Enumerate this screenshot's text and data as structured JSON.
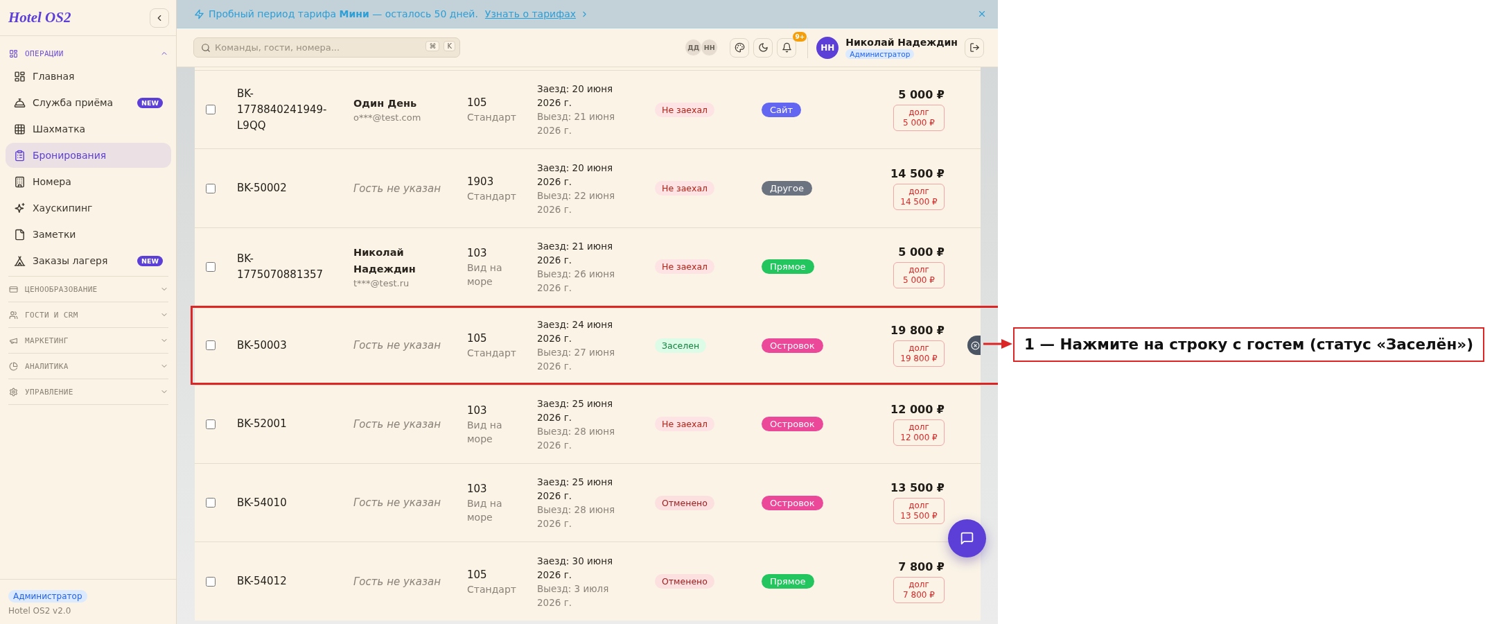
{
  "banner": {
    "message": "Пробный период тарифа **Мини** — осталось 50 дней.",
    "link": "Узнать о тарифах"
  },
  "sidebar": {
    "logo": "Hotel OS2",
    "sections": [
      {
        "label": "ОПЕРАЦИИ",
        "expanded": true,
        "items": [
          {
            "label": "Главная",
            "selected": false
          },
          {
            "label": "Служба приёма",
            "selected": false,
            "badge": "NEW"
          },
          {
            "label": "Шахматка",
            "selected": false
          },
          {
            "label": "Бронирования",
            "selected": true
          },
          {
            "label": "Номера",
            "selected": false
          },
          {
            "label": "Хаускипинг",
            "selected": false
          },
          {
            "label": "Заметки",
            "selected": false
          },
          {
            "label": "Заказы лагеря",
            "selected": false,
            "badge": "NEW"
          }
        ]
      },
      {
        "label": "ЦЕНООБРАЗОВАНИЕ",
        "expanded": false
      },
      {
        "label": "ГОСТИ И CRM",
        "expanded": false
      },
      {
        "label": "МАРКЕТИНГ",
        "expanded": false
      },
      {
        "label": "АНАЛИТИКА",
        "expanded": false
      },
      {
        "label": "УПРАВЛЕНИЕ",
        "expanded": false
      }
    ],
    "footer": {
      "role": "Администратор",
      "version": "Hotel OS2 v2.0"
    }
  },
  "topbar": {
    "search": {
      "placeholder": "Команды, гости, номера...",
      "shortcut": [
        "⌘",
        "K"
      ]
    },
    "online_users": [
      "ДД",
      "НН"
    ],
    "notifications_badge": "9+",
    "user": {
      "initials": "НН",
      "name": "Николай Надеждин",
      "role": "Администратор"
    }
  },
  "table": {
    "rows": [
      {
        "selected": false,
        "id": "BK-1778840241949-L9QQ",
        "guest": {
          "kind": "known",
          "name": "Один День",
          "email": "o***@test.com"
        },
        "room": {
          "number": "105",
          "type": "Стандарт"
        },
        "check_in": "Заезд: 20 июня 2026 г.",
        "check_out": "Выезд: 21 июня 2026 г.",
        "status": {
          "label": "Не заехал",
          "kind": "not_arrived"
        },
        "source": {
          "label": "Сайт",
          "color": "#6366f1"
        },
        "total": "5 000 ₽",
        "debt": {
          "label": "долг",
          "amount": "5 000 ₽"
        },
        "highlighted": false,
        "hovered": false
      },
      {
        "selected": false,
        "id": "BK-50002",
        "guest": {
          "kind": "unknown",
          "name": "Гость не указан"
        },
        "room": {
          "number": "1903",
          "type": "Стандарт"
        },
        "check_in": "Заезд: 20 июня 2026 г.",
        "check_out": "Выезд: 22 июня 2026 г.",
        "status": {
          "label": "Не заехал",
          "kind": "not_arrived"
        },
        "source": {
          "label": "Другое",
          "color": "#6b7280"
        },
        "total": "14 500 ₽",
        "debt": {
          "label": "долг",
          "amount": "14 500 ₽"
        },
        "highlighted": false,
        "hovered": false
      },
      {
        "selected": false,
        "id": "BK-1775070881357",
        "guest": {
          "kind": "known",
          "name": "Николай Надеждин",
          "email": "t***@test.ru"
        },
        "room": {
          "number": "103",
          "type": "Вид на море"
        },
        "check_in": "Заезд: 21 июня 2026 г.",
        "check_out": "Выезд: 26 июня 2026 г.",
        "status": {
          "label": "Не заехал",
          "kind": "not_arrived"
        },
        "source": {
          "label": "Прямое",
          "color": "#22c55e"
        },
        "total": "5 000 ₽",
        "debt": {
          "label": "долг",
          "amount": "5 000 ₽"
        },
        "highlighted": false,
        "hovered": false
      },
      {
        "selected": false,
        "id": "BK-50003",
        "guest": {
          "kind": "unknown",
          "name": "Гость не указан"
        },
        "room": {
          "number": "105",
          "type": "Стандарт"
        },
        "check_in": "Заезд: 24 июня 2026 г.",
        "check_out": "Выезд: 27 июня 2026 г.",
        "status": {
          "label": "Заселен",
          "kind": "checked_in"
        },
        "source": {
          "label": "Островок",
          "color": "#ec4899"
        },
        "total": "19 800 ₽",
        "debt": {
          "label": "долг",
          "amount": "19 800 ₽"
        },
        "highlighted": true,
        "hovered": true
      },
      {
        "selected": false,
        "id": "BK-52001",
        "guest": {
          "kind": "unknown",
          "name": "Гость не указан"
        },
        "room": {
          "number": "103",
          "type": "Вид на море"
        },
        "check_in": "Заезд: 25 июня 2026 г.",
        "check_out": "Выезд: 28 июня 2026 г.",
        "status": {
          "label": "Не заехал",
          "kind": "not_arrived"
        },
        "source": {
          "label": "Островок",
          "color": "#ec4899"
        },
        "total": "12 000 ₽",
        "debt": {
          "label": "долг",
          "amount": "12 000 ₽"
        },
        "highlighted": false,
        "hovered": false
      },
      {
        "selected": false,
        "id": "BK-54010",
        "guest": {
          "kind": "unknown",
          "name": "Гость не указан"
        },
        "room": {
          "number": "103",
          "type": "Вид на море"
        },
        "check_in": "Заезд: 25 июня 2026 г.",
        "check_out": "Выезд: 28 июня 2026 г.",
        "status": {
          "label": "Отменено",
          "kind": "cancelled"
        },
        "source": {
          "label": "Островок",
          "color": "#ec4899"
        },
        "total": "13 500 ₽",
        "debt": {
          "label": "долг",
          "amount": "13 500 ₽"
        },
        "highlighted": false,
        "hovered": false
      },
      {
        "selected": false,
        "id": "BK-54012",
        "guest": {
          "kind": "unknown",
          "name": "Гость не указан"
        },
        "room": {
          "number": "105",
          "type": "Стандарт"
        },
        "check_in": "Заезд: 30 июня 2026 г.",
        "check_out": "Выезд: 3 июля 2026 г.",
        "status": {
          "label": "Отменено",
          "kind": "cancelled"
        },
        "source": {
          "label": "Прямое",
          "color": "#22c55e"
        },
        "total": "7 800 ₽",
        "debt": {
          "label": "долг",
          "amount": "7 800 ₽"
        },
        "highlighted": false,
        "hovered": false
      }
    ]
  },
  "callout": {
    "text": "1 — Нажмите на строку с гостем (статус «Заселён»)"
  }
}
